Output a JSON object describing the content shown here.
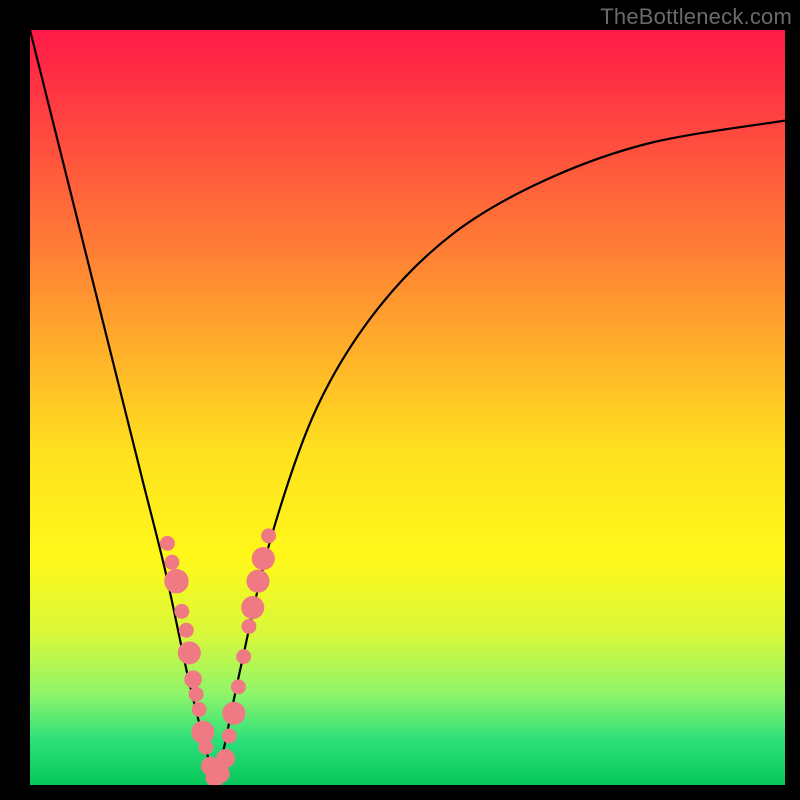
{
  "watermark": "TheBottleneck.com",
  "chart_data": {
    "type": "line",
    "title": "",
    "xlabel": "",
    "ylabel": "",
    "xlim": [
      0,
      100
    ],
    "ylim": [
      0,
      100
    ],
    "grid": false,
    "series": [
      {
        "name": "bottleneck-curve",
        "x": [
          0,
          3,
          6,
          9,
          12,
          15,
          18,
          21,
          23.5,
          24.5,
          25.5,
          28,
          32,
          38,
          46,
          56,
          68,
          82,
          100
        ],
        "y": [
          100,
          88,
          76,
          64,
          52,
          40,
          28,
          14,
          4,
          0.5,
          4,
          16,
          33,
          50,
          63,
          73,
          80,
          85,
          88
        ]
      }
    ],
    "markers": {
      "name": "highlight-dots",
      "color": "#f07a84",
      "points": [
        {
          "x": 18.2,
          "y": 32.0,
          "r": 1.1
        },
        {
          "x": 18.8,
          "y": 29.5,
          "r": 1.1
        },
        {
          "x": 19.4,
          "y": 27.0,
          "r": 1.8
        },
        {
          "x": 20.1,
          "y": 23.0,
          "r": 1.1
        },
        {
          "x": 20.7,
          "y": 20.5,
          "r": 1.1
        },
        {
          "x": 21.1,
          "y": 17.5,
          "r": 1.7
        },
        {
          "x": 21.6,
          "y": 14.0,
          "r": 1.3
        },
        {
          "x": 22.0,
          "y": 12.0,
          "r": 1.1
        },
        {
          "x": 22.4,
          "y": 10.0,
          "r": 1.1
        },
        {
          "x": 22.9,
          "y": 7.0,
          "r": 1.7
        },
        {
          "x": 23.3,
          "y": 5.0,
          "r": 1.1
        },
        {
          "x": 23.9,
          "y": 2.5,
          "r": 1.4
        },
        {
          "x": 24.5,
          "y": 1.0,
          "r": 1.4
        },
        {
          "x": 25.2,
          "y": 1.5,
          "r": 1.4
        },
        {
          "x": 25.9,
          "y": 3.5,
          "r": 1.4
        },
        {
          "x": 26.4,
          "y": 6.5,
          "r": 1.1
        },
        {
          "x": 27.0,
          "y": 9.5,
          "r": 1.7
        },
        {
          "x": 27.6,
          "y": 13.0,
          "r": 1.1
        },
        {
          "x": 28.3,
          "y": 17.0,
          "r": 1.1
        },
        {
          "x": 29.0,
          "y": 21.0,
          "r": 1.1
        },
        {
          "x": 29.5,
          "y": 23.5,
          "r": 1.7
        },
        {
          "x": 30.2,
          "y": 27.0,
          "r": 1.7
        },
        {
          "x": 30.9,
          "y": 30.0,
          "r": 1.7
        },
        {
          "x": 31.6,
          "y": 33.0,
          "r": 1.1
        }
      ]
    }
  }
}
